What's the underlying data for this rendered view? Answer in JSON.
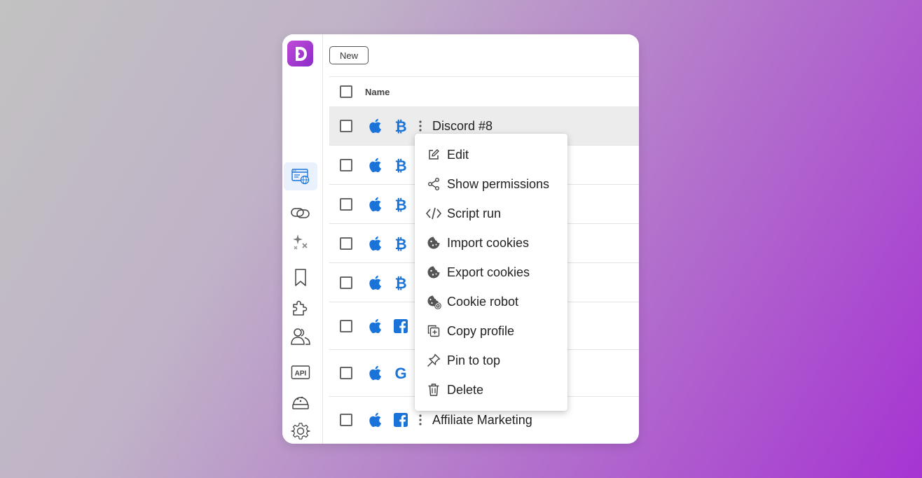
{
  "toolbar": {
    "new_label": "New"
  },
  "table": {
    "header_name": "Name",
    "rows": [
      {
        "name": "Discord #8",
        "os_icon": "apple-icon",
        "site_icon": "bitcoin-icon"
      },
      {
        "name": "",
        "os_icon": "apple-icon",
        "site_icon": "bitcoin-icon"
      },
      {
        "name": "",
        "os_icon": "apple-icon",
        "site_icon": "bitcoin-icon"
      },
      {
        "name": "",
        "os_icon": "apple-icon",
        "site_icon": "bitcoin-icon"
      },
      {
        "name": "",
        "os_icon": "apple-icon",
        "site_icon": "bitcoin-icon"
      },
      {
        "name": "",
        "os_icon": "apple-icon",
        "site_icon": "facebook-icon"
      },
      {
        "name": "",
        "os_icon": "apple-icon",
        "site_icon": "google-icon"
      },
      {
        "name": "Affiliate Marketing",
        "os_icon": "apple-icon",
        "site_icon": "facebook-icon"
      }
    ]
  },
  "context_menu": {
    "items": [
      {
        "label": "Edit",
        "icon": "edit-icon"
      },
      {
        "label": "Show permissions",
        "icon": "share-icon"
      },
      {
        "label": "Script run",
        "icon": "code-icon"
      },
      {
        "label": "Import cookies",
        "icon": "cookie-icon"
      },
      {
        "label": "Export cookies",
        "icon": "cookie-icon"
      },
      {
        "label": "Cookie robot",
        "icon": "cookie-gear-icon"
      },
      {
        "label": "Copy profile",
        "icon": "copy-icon"
      },
      {
        "label": "Pin to top",
        "icon": "pin-icon"
      },
      {
        "label": "Delete",
        "icon": "trash-icon"
      }
    ]
  },
  "sidebar": {
    "items": [
      {
        "icon": "browser-profiles-icon",
        "active": true
      },
      {
        "icon": "proxy-link-icon"
      },
      {
        "icon": "sparkles-icon"
      },
      {
        "icon": "bookmark-icon"
      },
      {
        "icon": "extensions-puzzle-icon"
      },
      {
        "icon": "users-icon"
      },
      {
        "icon": "api-icon",
        "label": "API"
      },
      {
        "icon": "cookie-robot-icon"
      },
      {
        "icon": "settings-gear-icon"
      }
    ]
  },
  "colors": {
    "accent": "#1a73d9",
    "brand": "#a535d0",
    "hover_row": "#ececec"
  }
}
